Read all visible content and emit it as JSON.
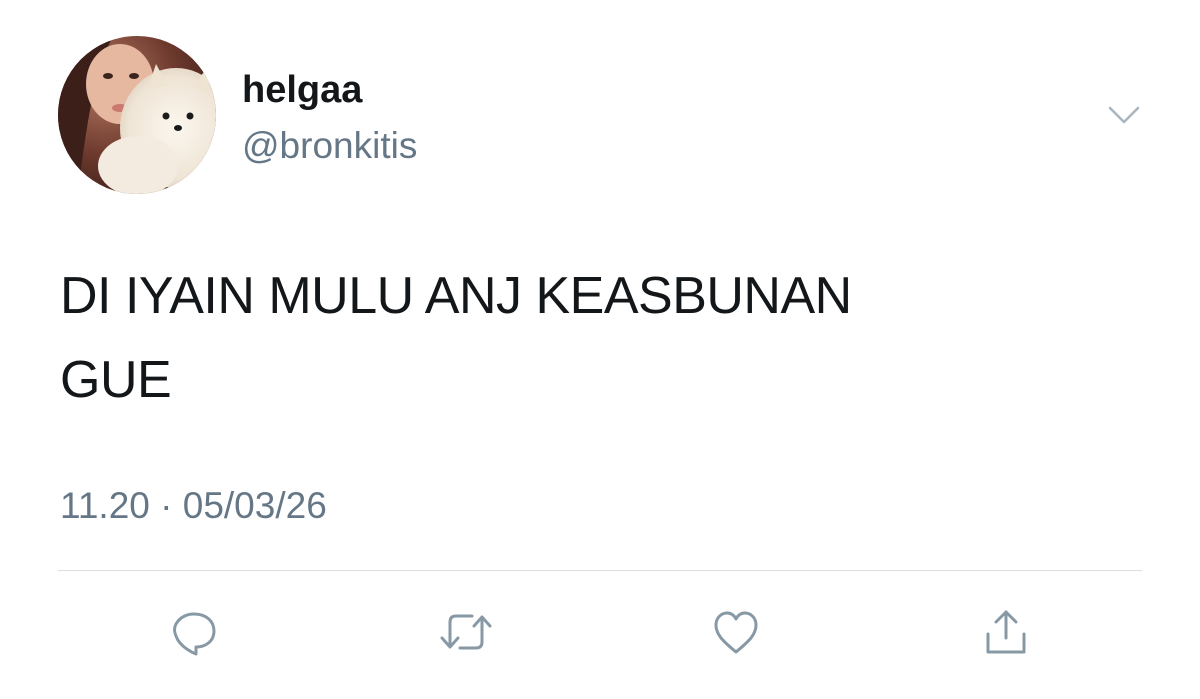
{
  "user": {
    "display_name": "helgaa",
    "handle": "@bronkitis"
  },
  "tweet": {
    "text_line1": "DI IYAIN MULU ANJ KEASBUNAN",
    "text_line2": "GUE",
    "time": "11.20",
    "separator": "·",
    "date": "05/03/26"
  },
  "actions": [
    {
      "icon": "reply-icon"
    },
    {
      "icon": "retweet-icon"
    },
    {
      "icon": "like-icon"
    },
    {
      "icon": "share-icon"
    }
  ],
  "colors": {
    "text": "#14171a",
    "secondary": "#657786",
    "divider": "#d9dee2",
    "icon": "#8899a6"
  }
}
